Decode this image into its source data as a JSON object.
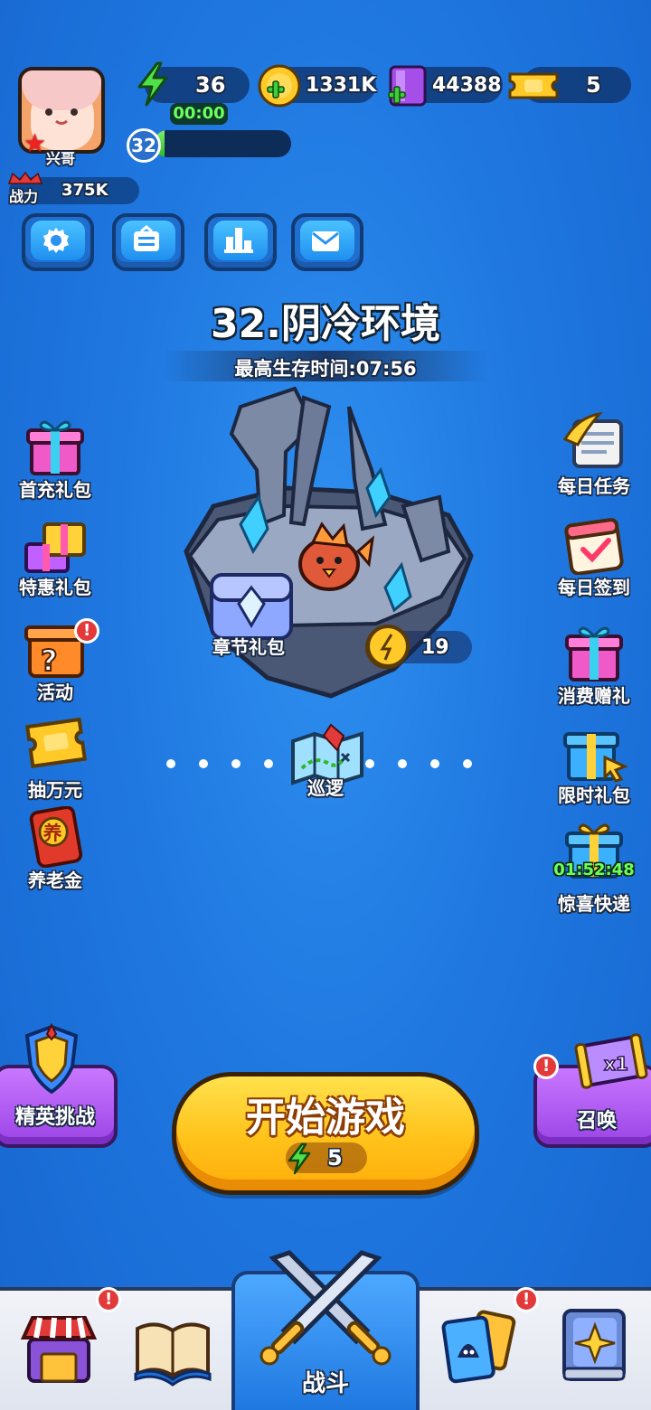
{
  "player": {
    "name": "兴哥",
    "power_label": "战力",
    "power_value": "375K",
    "level": "32",
    "xp_fraction": 0.08
  },
  "resources": {
    "energy": "36",
    "energy_timer": "00:00",
    "gold": "1331K",
    "gems": "44388",
    "tickets": "5"
  },
  "stage": {
    "title": "32.阴冷环境",
    "survive_time": "最高生存时间:07:56",
    "chapter_gift": "章节礼包",
    "coins": "19",
    "patrol": "巡逻"
  },
  "left_menu": [
    {
      "label": "首充礼包",
      "icon": "gift-box-icon"
    },
    {
      "label": "特惠礼包",
      "icon": "gift-stack-icon"
    },
    {
      "label": "活动",
      "icon": "mystery-box-icon",
      "badge": "!"
    },
    {
      "label": "抽万元",
      "icon": "ticket-icon"
    },
    {
      "label": "养老金",
      "icon": "pension-envelope-icon",
      "badge_char": "养"
    }
  ],
  "right_menu": [
    {
      "label": "每日任务",
      "icon": "scroll-quill-icon"
    },
    {
      "label": "每日签到",
      "icon": "calendar-check-icon"
    },
    {
      "label": "消费赠礼",
      "icon": "gift-box-icon"
    },
    {
      "label": "限时礼包",
      "icon": "gift-cursor-icon"
    },
    {
      "label": "惊喜快递",
      "icon": "gift-box-icon",
      "timer": "01:52:48"
    }
  ],
  "buttons": {
    "elite": "精英挑战",
    "start": "开始游戏",
    "start_cost": "5",
    "summon": "召唤",
    "summon_badge": "x1"
  },
  "nav": {
    "active_label": "战斗"
  },
  "colors": {
    "background": "#1f78e0",
    "start_yellow": "#ffc21a",
    "purple": "#9b44e6",
    "energy_green": "#6dff5c",
    "badge_red": "#e23a3a"
  }
}
